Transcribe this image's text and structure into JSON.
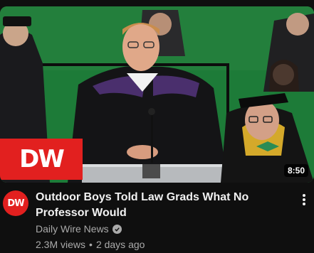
{
  "video": {
    "duration": "8:50",
    "badge_text": "DW",
    "title": "Outdoor Boys Told Law Grads What No Professor Would",
    "channel": "Daily Wire News",
    "views": "2.3M views",
    "separator": "•",
    "age": "2 days ago",
    "avatar_text": "DW"
  },
  "icons": {
    "verified": "verified-check-icon",
    "menu": "more-vert-icon"
  },
  "colors": {
    "background": "#0f0f0f",
    "brand_red": "#e2201f",
    "title_text": "#f1f1f1",
    "meta_text": "#aaaaaa"
  }
}
